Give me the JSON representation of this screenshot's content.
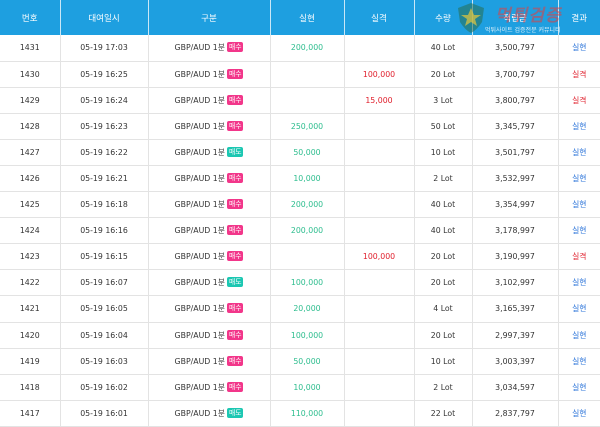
{
  "headers": [
    "번호",
    "대여일시",
    "구분",
    "실현",
    "실격",
    "수량",
    "적립금",
    "결과"
  ],
  "rows": [
    {
      "no": "1431",
      "datetime": "05-19 17:03",
      "pair": "GBP/AUD 1분",
      "dir": "매수",
      "win": "200,000",
      "loss": "",
      "qty": "40 Lot",
      "amount": "3,500,797",
      "result": "실현"
    },
    {
      "no": "1430",
      "datetime": "05-19 16:25",
      "pair": "GBP/AUD 1분",
      "dir": "매수",
      "win": "",
      "loss": "100,000",
      "qty": "20 Lot",
      "amount": "3,700,797",
      "result": "실격"
    },
    {
      "no": "1429",
      "datetime": "05-19 16:24",
      "pair": "GBP/AUD 1분",
      "dir": "매수",
      "win": "",
      "loss": "15,000",
      "qty": "3 Lot",
      "amount": "3,800,797",
      "result": "실격"
    },
    {
      "no": "1428",
      "datetime": "05-19 16:23",
      "pair": "GBP/AUD 1분",
      "dir": "매수",
      "win": "250,000",
      "loss": "",
      "qty": "50 Lot",
      "amount": "3,345,797",
      "result": "실현"
    },
    {
      "no": "1427",
      "datetime": "05-19 16:22",
      "pair": "GBP/AUD 1분",
      "dir": "매도",
      "win": "50,000",
      "loss": "",
      "qty": "10 Lot",
      "amount": "3,501,797",
      "result": "실현"
    },
    {
      "no": "1426",
      "datetime": "05-19 16:21",
      "pair": "GBP/AUD 1분",
      "dir": "매수",
      "win": "10,000",
      "loss": "",
      "qty": "2 Lot",
      "amount": "3,532,997",
      "result": "실현"
    },
    {
      "no": "1425",
      "datetime": "05-19 16:18",
      "pair": "GBP/AUD 1분",
      "dir": "매수",
      "win": "200,000",
      "loss": "",
      "qty": "40 Lot",
      "amount": "3,354,997",
      "result": "실현"
    },
    {
      "no": "1424",
      "datetime": "05-19 16:16",
      "pair": "GBP/AUD 1분",
      "dir": "매수",
      "win": "200,000",
      "loss": "",
      "qty": "40 Lot",
      "amount": "3,178,997",
      "result": "실현"
    },
    {
      "no": "1423",
      "datetime": "05-19 16:15",
      "pair": "GBP/AUD 1분",
      "dir": "매수",
      "win": "",
      "loss": "100,000",
      "qty": "20 Lot",
      "amount": "3,190,997",
      "result": "실격"
    },
    {
      "no": "1422",
      "datetime": "05-19 16:07",
      "pair": "GBP/AUD 1분",
      "dir": "매도",
      "win": "100,000",
      "loss": "",
      "qty": "20 Lot",
      "amount": "3,102,997",
      "result": "실현"
    },
    {
      "no": "1421",
      "datetime": "05-19 16:05",
      "pair": "GBP/AUD 1분",
      "dir": "매수",
      "win": "20,000",
      "loss": "",
      "qty": "4 Lot",
      "amount": "3,165,397",
      "result": "실현"
    },
    {
      "no": "1420",
      "datetime": "05-19 16:04",
      "pair": "GBP/AUD 1분",
      "dir": "매수",
      "win": "100,000",
      "loss": "",
      "qty": "20 Lot",
      "amount": "2,997,397",
      "result": "실현"
    },
    {
      "no": "1419",
      "datetime": "05-19 16:03",
      "pair": "GBP/AUD 1분",
      "dir": "매수",
      "win": "50,000",
      "loss": "",
      "qty": "10 Lot",
      "amount": "3,003,397",
      "result": "실현"
    },
    {
      "no": "1418",
      "datetime": "05-19 16:02",
      "pair": "GBP/AUD 1분",
      "dir": "매수",
      "win": "10,000",
      "loss": "",
      "qty": "2 Lot",
      "amount": "3,034,597",
      "result": "실현"
    },
    {
      "no": "1417",
      "datetime": "05-19 16:01",
      "pair": "GBP/AUD 1분",
      "dir": "매도",
      "win": "110,000",
      "loss": "",
      "qty": "22 Lot",
      "amount": "2,837,797",
      "result": "실현"
    }
  ],
  "watermark": {
    "title": "먹튀검증",
    "subtitle": "먹튀사이트 검증전문 커뮤니티"
  },
  "colors": {
    "header": "#1e9fe0",
    "win": "#2dbd8e",
    "loss": "#e0202d",
    "result_win": "#2a73d9",
    "buy": "#f2368a",
    "sell": "#1cc7b2"
  }
}
